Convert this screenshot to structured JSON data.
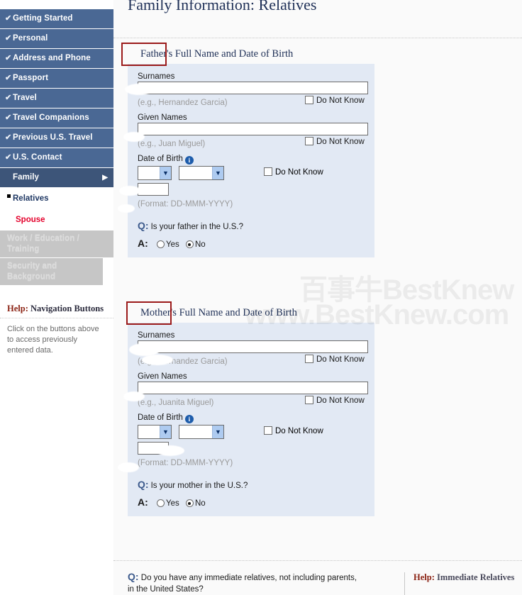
{
  "sidebar": {
    "nav_items": [
      {
        "label": "Getting Started",
        "state": "completed",
        "check": "✔"
      },
      {
        "label": "Personal",
        "state": "completed",
        "check": "✔"
      },
      {
        "label": "Address and Phone",
        "state": "completed",
        "check": "✔"
      },
      {
        "label": "Passport",
        "state": "completed",
        "check": "✔"
      },
      {
        "label": "Travel",
        "state": "completed",
        "check": "✔"
      },
      {
        "label": "Travel Companions",
        "state": "completed",
        "check": "✔"
      },
      {
        "label": "Previous U.S. Travel",
        "state": "completed",
        "check": "✔"
      },
      {
        "label": "U.S. Contact",
        "state": "completed",
        "check": "✔"
      },
      {
        "label": "Family",
        "state": "active",
        "arrow": "▶"
      }
    ],
    "sub_items": [
      {
        "label": "Relatives",
        "state": "current"
      },
      {
        "label": "Spouse",
        "state": "link"
      }
    ],
    "disabled_items": [
      {
        "label": "Work / Education / Training"
      },
      {
        "label": "Security and Background"
      }
    ],
    "help": {
      "prefix": "Help:",
      "title": "Navigation Buttons",
      "body": "Click on the buttons above to access previously entered data."
    }
  },
  "main": {
    "page_title": "Family Information: Relatives",
    "father": {
      "heading": "Father's Full Name and Date of Birth",
      "surnames_label": "Surnames",
      "surnames_value": "",
      "surnames_hint": "(e.g., Hernandez Garcia)",
      "surnames_dnk": "Do Not Know",
      "given_label": "Given Names",
      "given_value": "",
      "given_hint": "(e.g., Juan Miguel)",
      "given_dnk": "Do Not Know",
      "dob_label": "Date of Birth",
      "dob_info_icon": "i",
      "dob_day": "",
      "dob_month": "",
      "dob_year": "",
      "dob_dnk": "Do Not Know",
      "dob_format": "(Format: DD-MMM-YYYY)",
      "q_marker": "Q:",
      "question": "Is your father in the U.S.?",
      "a_marker": "A:",
      "option_yes": "Yes",
      "option_no": "No",
      "selected": "No"
    },
    "mother": {
      "heading": "Mother's Full Name and Date of Birth",
      "surnames_label": "Surnames",
      "surnames_value": "",
      "surnames_hint": "(e.g., Hernandez Garcia)",
      "surnames_dnk": "Do Not Know",
      "given_label": "Given Names",
      "given_value": "",
      "given_hint": "(e.g., Juanita Miguel)",
      "given_dnk": "Do Not Know",
      "dob_label": "Date of Birth",
      "dob_info_icon": "i",
      "dob_day": "",
      "dob_month": "",
      "dob_year": "",
      "dob_dnk": "Do Not Know",
      "dob_format": "(Format: DD-MMM-YYYY)",
      "q_marker": "Q:",
      "question": "Is your mother in the U.S.?",
      "a_marker": "A:",
      "option_yes": "Yes",
      "option_no": "No",
      "selected": "No"
    },
    "bottom_question": {
      "q_marker": "Q:",
      "text": "Do you have any immediate relatives, not including parents, in the United States?",
      "help_prefix": "Help:",
      "help_title": "Immediate Relatives"
    }
  },
  "watermark": {
    "line1": "百事牛BestKnew",
    "line2": "www.BestKnew.com"
  },
  "colors": {
    "nav_blue": "#4a6894",
    "nav_active": "#3d5579",
    "panel_blue": "#e2e9f4",
    "title_navy": "#1f3057",
    "accent_red": "#e4002b",
    "help_red": "#8b2314",
    "highlight_box": "#9b1a1a",
    "disabled_gray": "#c6c6c6"
  }
}
